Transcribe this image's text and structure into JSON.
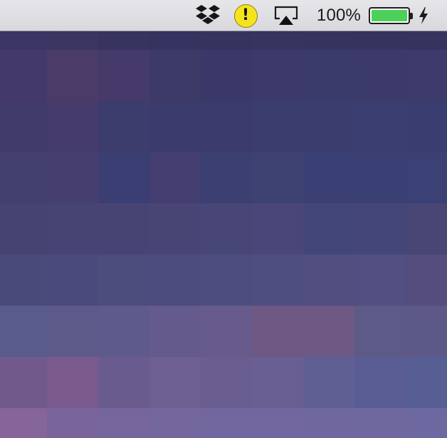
{
  "menubar": {
    "status_items": [
      {
        "icon": "dropbox-icon"
      },
      {
        "icon": "alert-icon",
        "glyph": "!",
        "color": "#f4e41c"
      },
      {
        "icon": "airplay-icon"
      }
    ],
    "battery": {
      "percent_label": "100%",
      "charge_fraction": 1.0,
      "fill_color": "#4cd05a",
      "charging": true,
      "charging_icon": "lightning-bolt-icon"
    }
  },
  "wallpaper": {
    "style": "pixelated purple-blue gradient",
    "rows": [
      [
        "#3a3563",
        "#3b3561",
        "#383460",
        "#35335f",
        "#36345f",
        "#37345f",
        "#36345f",
        "#35345f",
        "#36345f"
      ],
      [
        "#433a6a",
        "#4b3b69",
        "#453a6a",
        "#3d3a68",
        "#3a3868",
        "#3b3a6a",
        "#3a3a6b",
        "#3c3a6b",
        "#3c3b6c"
      ],
      [
        "#403b6b",
        "#453c6b",
        "#3c3c6d",
        "#3b3c6d",
        "#3b3c6d",
        "#3a3d6e",
        "#3b3d6f",
        "#3a3e70",
        "#393d70"
      ],
      [
        "#423e6e",
        "#453e6e",
        "#3b3e72",
        "#433e6f",
        "#3c3f71",
        "#3e4272",
        "#3a4073",
        "#3a3f74",
        "#3b4075"
      ],
      [
        "#474371",
        "#464473",
        "#474474",
        "#484575",
        "#474677",
        "#4a4679",
        "#434679",
        "#444679",
        "#484673"
      ],
      [
        "#4a4a7a",
        "#4a4b7c",
        "#4c4c7d",
        "#4d4c7e",
        "#4e4d7f",
        "#4f4e80",
        "#514f80",
        "#524f82",
        "#544d7e"
      ],
      [
        "#585b8c",
        "#5d5a8a",
        "#5e5b8c",
        "#645b8c",
        "#665b8a",
        "#6e5884",
        "#6e5884",
        "#5e5a88",
        "#5c5888"
      ],
      [
        "#705a8c",
        "#7a5a8d",
        "#6a5b8e",
        "#6d5f90",
        "#6a5e90",
        "#6a5f92",
        "#605f94",
        "#5a5d94",
        "#575e94"
      ],
      [
        "#85659a",
        "#7a649c",
        "#76669d",
        "#74679e",
        "#72679e",
        "#72679e",
        "#6f679e",
        "#6f689f",
        "#6e68a0"
      ]
    ]
  }
}
